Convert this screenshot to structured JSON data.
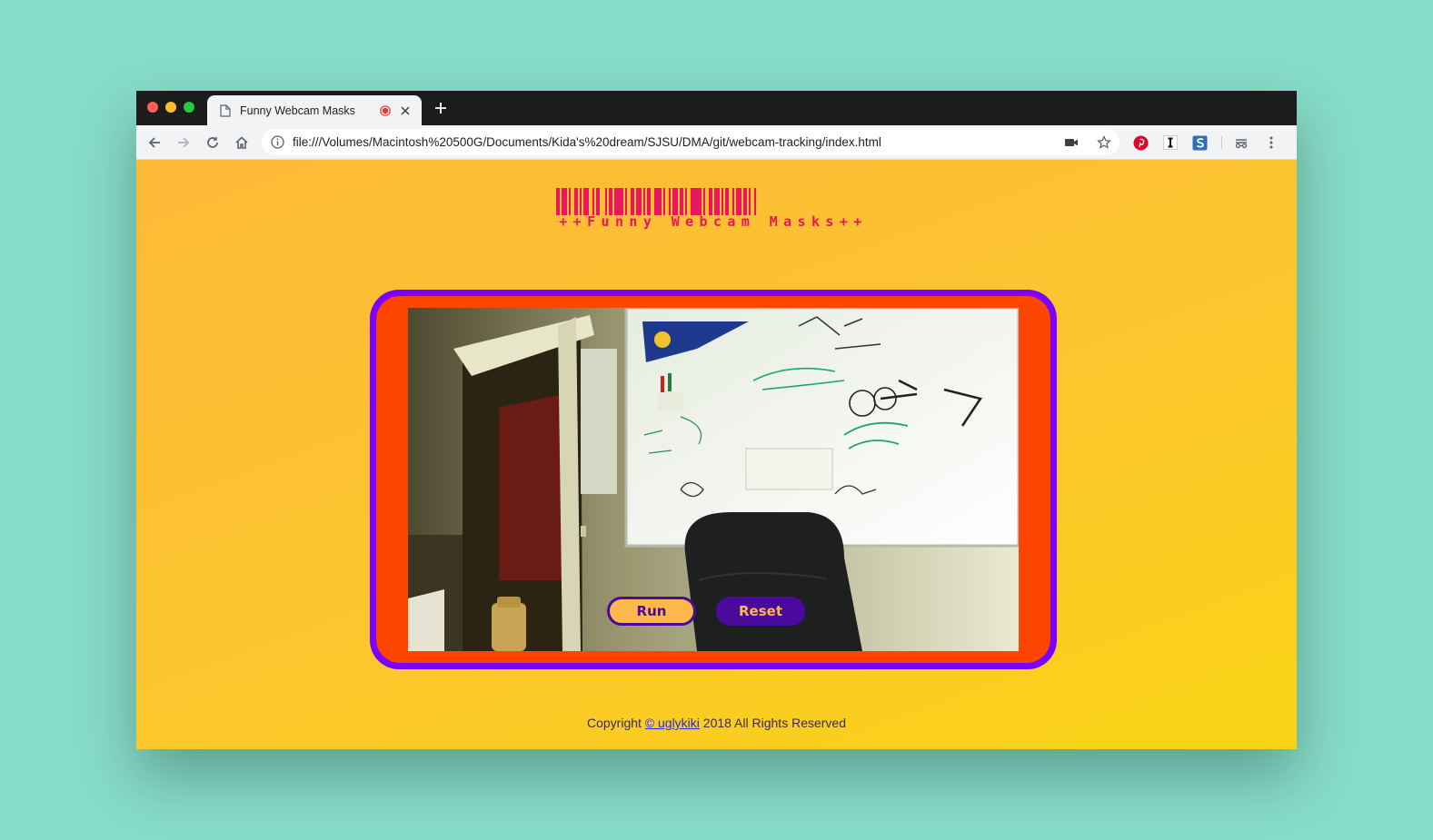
{
  "browser": {
    "tab_title": "Funny Webcam Masks",
    "url": "file:///Volumes/Macintosh%20500G/Documents/Kida's%20dream/SJSU/DMA/git/webcam-tracking/index.html",
    "icons": [
      "back-icon",
      "forward-icon",
      "reload-icon",
      "home-icon",
      "info-icon",
      "camera-icon",
      "star-icon",
      "pinterest-icon",
      "instapaper-icon",
      "s-extension-icon",
      "extension-icon",
      "menu-icon"
    ]
  },
  "page": {
    "logo_text": "++Funny Webcam Masks++",
    "buttons": {
      "run": "Run",
      "reset": "Reset"
    },
    "footer": {
      "prefix": "Copyright ",
      "link": "© uglykiki",
      "suffix": " 2018 All Rights Reserved"
    },
    "colors": {
      "background_teal": "#86dcc8",
      "page_yellow": "#fcc62e",
      "logo_pink": "#e8175d",
      "frame_purple": "#7b00ff",
      "frame_orange": "#fe4500",
      "button_purple": "#4b0a9e",
      "button_orange": "#fdb74a"
    }
  }
}
